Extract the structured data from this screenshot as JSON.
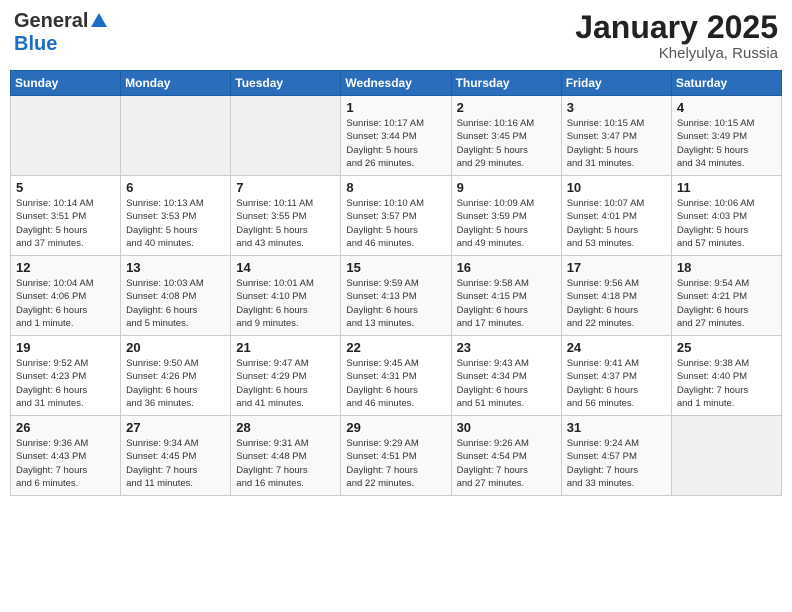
{
  "header": {
    "logo_general": "General",
    "logo_blue": "Blue",
    "month_title": "January 2025",
    "subtitle": "Khelyulya, Russia"
  },
  "days_of_week": [
    "Sunday",
    "Monday",
    "Tuesday",
    "Wednesday",
    "Thursday",
    "Friday",
    "Saturday"
  ],
  "weeks": [
    [
      {
        "day": "",
        "info": ""
      },
      {
        "day": "",
        "info": ""
      },
      {
        "day": "",
        "info": ""
      },
      {
        "day": "1",
        "info": "Sunrise: 10:17 AM\nSunset: 3:44 PM\nDaylight: 5 hours\nand 26 minutes."
      },
      {
        "day": "2",
        "info": "Sunrise: 10:16 AM\nSunset: 3:45 PM\nDaylight: 5 hours\nand 29 minutes."
      },
      {
        "day": "3",
        "info": "Sunrise: 10:15 AM\nSunset: 3:47 PM\nDaylight: 5 hours\nand 31 minutes."
      },
      {
        "day": "4",
        "info": "Sunrise: 10:15 AM\nSunset: 3:49 PM\nDaylight: 5 hours\nand 34 minutes."
      }
    ],
    [
      {
        "day": "5",
        "info": "Sunrise: 10:14 AM\nSunset: 3:51 PM\nDaylight: 5 hours\nand 37 minutes."
      },
      {
        "day": "6",
        "info": "Sunrise: 10:13 AM\nSunset: 3:53 PM\nDaylight: 5 hours\nand 40 minutes."
      },
      {
        "day": "7",
        "info": "Sunrise: 10:11 AM\nSunset: 3:55 PM\nDaylight: 5 hours\nand 43 minutes."
      },
      {
        "day": "8",
        "info": "Sunrise: 10:10 AM\nSunset: 3:57 PM\nDaylight: 5 hours\nand 46 minutes."
      },
      {
        "day": "9",
        "info": "Sunrise: 10:09 AM\nSunset: 3:59 PM\nDaylight: 5 hours\nand 49 minutes."
      },
      {
        "day": "10",
        "info": "Sunrise: 10:07 AM\nSunset: 4:01 PM\nDaylight: 5 hours\nand 53 minutes."
      },
      {
        "day": "11",
        "info": "Sunrise: 10:06 AM\nSunset: 4:03 PM\nDaylight: 5 hours\nand 57 minutes."
      }
    ],
    [
      {
        "day": "12",
        "info": "Sunrise: 10:04 AM\nSunset: 4:06 PM\nDaylight: 6 hours\nand 1 minute."
      },
      {
        "day": "13",
        "info": "Sunrise: 10:03 AM\nSunset: 4:08 PM\nDaylight: 6 hours\nand 5 minutes."
      },
      {
        "day": "14",
        "info": "Sunrise: 10:01 AM\nSunset: 4:10 PM\nDaylight: 6 hours\nand 9 minutes."
      },
      {
        "day": "15",
        "info": "Sunrise: 9:59 AM\nSunset: 4:13 PM\nDaylight: 6 hours\nand 13 minutes."
      },
      {
        "day": "16",
        "info": "Sunrise: 9:58 AM\nSunset: 4:15 PM\nDaylight: 6 hours\nand 17 minutes."
      },
      {
        "day": "17",
        "info": "Sunrise: 9:56 AM\nSunset: 4:18 PM\nDaylight: 6 hours\nand 22 minutes."
      },
      {
        "day": "18",
        "info": "Sunrise: 9:54 AM\nSunset: 4:21 PM\nDaylight: 6 hours\nand 27 minutes."
      }
    ],
    [
      {
        "day": "19",
        "info": "Sunrise: 9:52 AM\nSunset: 4:23 PM\nDaylight: 6 hours\nand 31 minutes."
      },
      {
        "day": "20",
        "info": "Sunrise: 9:50 AM\nSunset: 4:26 PM\nDaylight: 6 hours\nand 36 minutes."
      },
      {
        "day": "21",
        "info": "Sunrise: 9:47 AM\nSunset: 4:29 PM\nDaylight: 6 hours\nand 41 minutes."
      },
      {
        "day": "22",
        "info": "Sunrise: 9:45 AM\nSunset: 4:31 PM\nDaylight: 6 hours\nand 46 minutes."
      },
      {
        "day": "23",
        "info": "Sunrise: 9:43 AM\nSunset: 4:34 PM\nDaylight: 6 hours\nand 51 minutes."
      },
      {
        "day": "24",
        "info": "Sunrise: 9:41 AM\nSunset: 4:37 PM\nDaylight: 6 hours\nand 56 minutes."
      },
      {
        "day": "25",
        "info": "Sunrise: 9:38 AM\nSunset: 4:40 PM\nDaylight: 7 hours\nand 1 minute."
      }
    ],
    [
      {
        "day": "26",
        "info": "Sunrise: 9:36 AM\nSunset: 4:43 PM\nDaylight: 7 hours\nand 6 minutes."
      },
      {
        "day": "27",
        "info": "Sunrise: 9:34 AM\nSunset: 4:45 PM\nDaylight: 7 hours\nand 11 minutes."
      },
      {
        "day": "28",
        "info": "Sunrise: 9:31 AM\nSunset: 4:48 PM\nDaylight: 7 hours\nand 16 minutes."
      },
      {
        "day": "29",
        "info": "Sunrise: 9:29 AM\nSunset: 4:51 PM\nDaylight: 7 hours\nand 22 minutes."
      },
      {
        "day": "30",
        "info": "Sunrise: 9:26 AM\nSunset: 4:54 PM\nDaylight: 7 hours\nand 27 minutes."
      },
      {
        "day": "31",
        "info": "Sunrise: 9:24 AM\nSunset: 4:57 PM\nDaylight: 7 hours\nand 33 minutes."
      },
      {
        "day": "",
        "info": ""
      }
    ]
  ]
}
